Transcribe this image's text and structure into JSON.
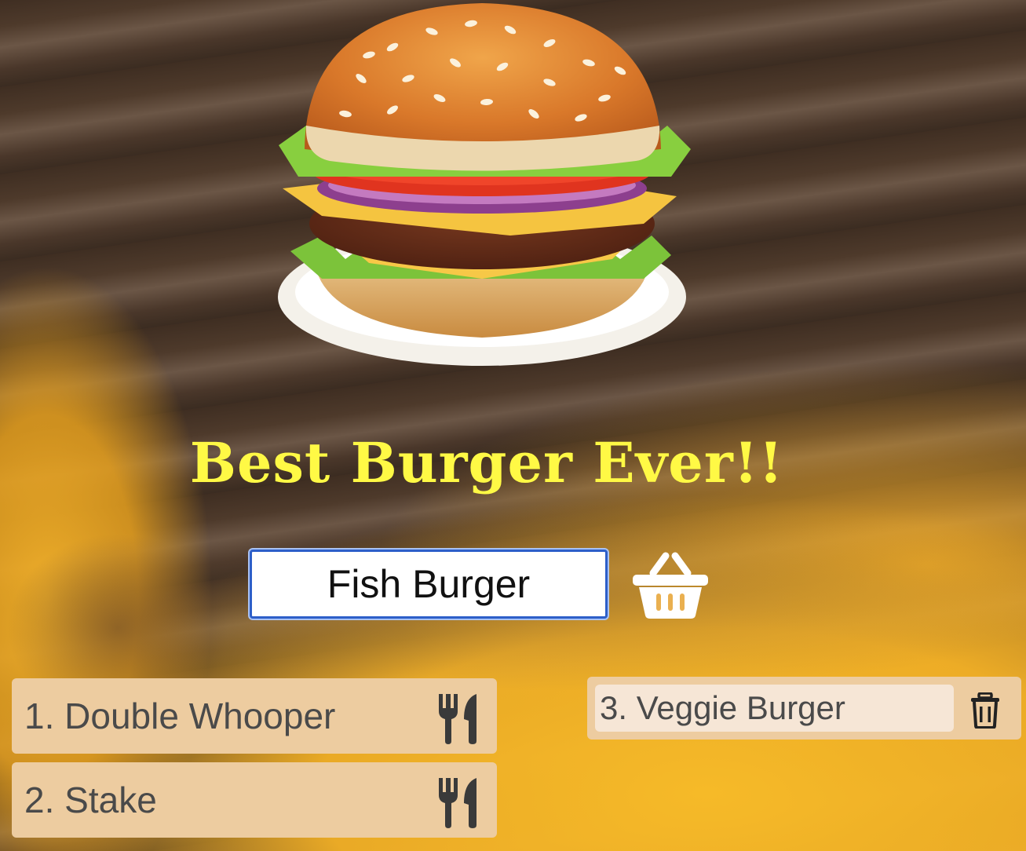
{
  "title": "Best Burger Ever!!",
  "input": {
    "value": "Fish Burger"
  },
  "icons": {
    "hero": "burger-illustration",
    "add": "basket-icon",
    "eat": "fork-knife-icon",
    "delete": "trash-icon"
  },
  "orders": [
    {
      "label": "1. Double Whooper"
    },
    {
      "label": "2. Stake"
    }
  ],
  "eaten": [
    {
      "label": "3. Veggie Burger"
    }
  ],
  "colors": {
    "title": "#fff945",
    "item_bg": "#edcca0",
    "done_inner_bg": "#f6e6d6",
    "input_border": "#2d5fc9"
  }
}
